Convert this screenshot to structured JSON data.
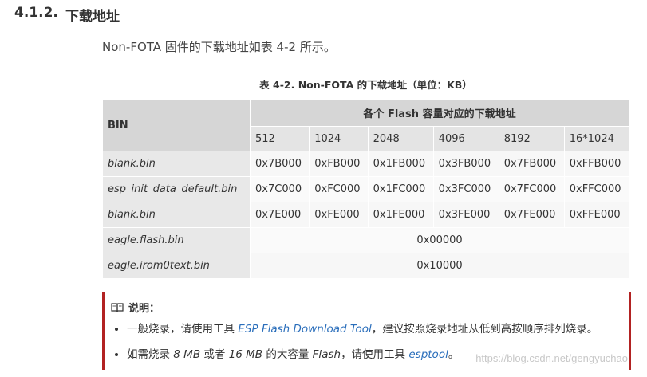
{
  "heading": {
    "number": "4.1.2.",
    "title": "下载地址"
  },
  "intro": "Non-FOTA 固件的下载地址如表 4-2 所示。",
  "table": {
    "caption": "表 4-2. Non-FOTA 的下载地址（单位：KB）",
    "bin_header": "BIN",
    "group_header": "各个 Flash 容量对应的下载地址",
    "sizes": [
      "512",
      "1024",
      "2048",
      "4096",
      "8192",
      "16*1024"
    ],
    "rows": [
      {
        "name": "blank.bin",
        "values": [
          "0x7B000",
          "0xFB000",
          "0x1FB000",
          "0x3FB000",
          "0x7FB000",
          "0xFFB000"
        ]
      },
      {
        "name": "esp_init_data_default.bin",
        "values": [
          "0x7C000",
          "0xFC000",
          "0x1FC000",
          "0x3FC000",
          "0x7FC000",
          "0xFFC000"
        ]
      },
      {
        "name": "blank.bin",
        "values": [
          "0x7E000",
          "0xFE000",
          "0x1FE000",
          "0x3FE000",
          "0x7FE000",
          "0xFFE000"
        ]
      },
      {
        "name": "eagle.flash.bin",
        "span_value": "0x00000"
      },
      {
        "name": "eagle.irom0text.bin",
        "span_value": "0x10000"
      }
    ]
  },
  "note": {
    "title": "说明：",
    "item1": {
      "pre": "一般烧录，请使用工具 ",
      "link": "ESP Flash Download Tool",
      "post": "，建议按照烧录地址从低到高按顺序排列烧录。"
    },
    "item2": {
      "a": "如需烧录 ",
      "b": "8 MB",
      "c": " 或者 ",
      "d": "16 MB",
      "e": " 的大容量 ",
      "f": "Flash",
      "g": "，请使用工具 ",
      "link": "esptool",
      "h": "。"
    }
  },
  "watermark": "https://blog.csdn.net/gengyuchao",
  "colors": {
    "accent_border": "#b22222",
    "link": "#2a6ebb",
    "header_bg": "#d6d6d6"
  }
}
